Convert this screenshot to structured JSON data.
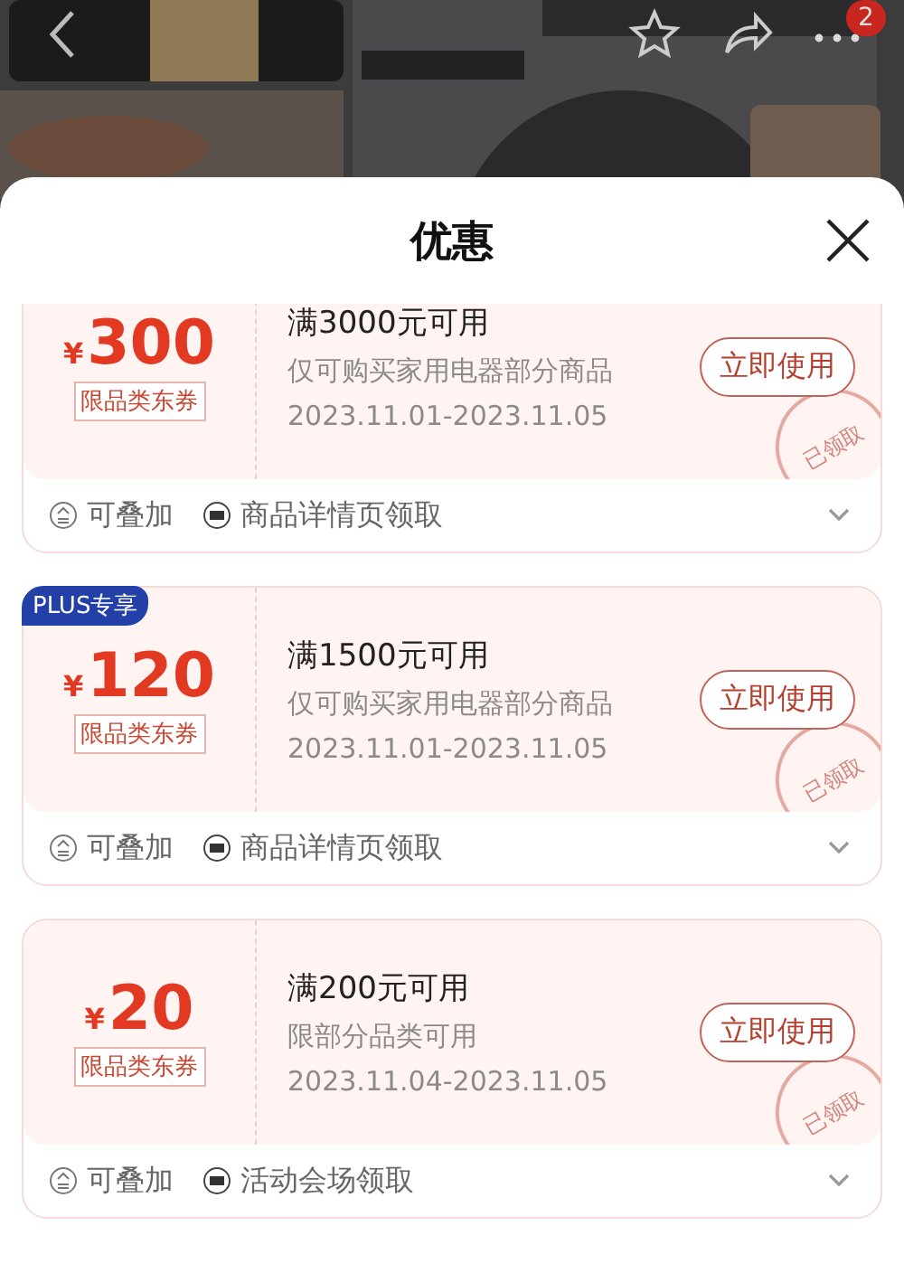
{
  "top_bar": {
    "cart_badge": "2"
  },
  "sheet": {
    "title": "优惠"
  },
  "coupons": [
    {
      "currency": "¥",
      "amount": "300",
      "tag": "限品类东券",
      "condition": "满3000元可用",
      "scope": "仅可购买家用电器部分商品",
      "validity": "2023.11.01-2023.11.05",
      "button": "立即使用",
      "stamp": "已领取",
      "claimed": true,
      "footer": [
        "可叠加",
        "商品详情页领取"
      ]
    },
    {
      "badge": "PLUS专享",
      "currency": "¥",
      "amount": "120",
      "tag": "限品类东券",
      "condition": "满1500元可用",
      "scope": "仅可购买家用电器部分商品",
      "validity": "2023.11.01-2023.11.05",
      "button": "立即使用",
      "stamp": "已领取",
      "claimed": true,
      "footer": [
        "可叠加",
        "商品详情页领取"
      ]
    },
    {
      "currency": "¥",
      "amount": "20",
      "tag": "限品类东券",
      "condition": "满200元可用",
      "scope": "限部分品类可用",
      "validity": "2023.11.04-2023.11.05",
      "button": "立即使用",
      "stamp": "已领取",
      "claimed": true,
      "footer": [
        "可叠加",
        "活动会场领取"
      ]
    }
  ]
}
